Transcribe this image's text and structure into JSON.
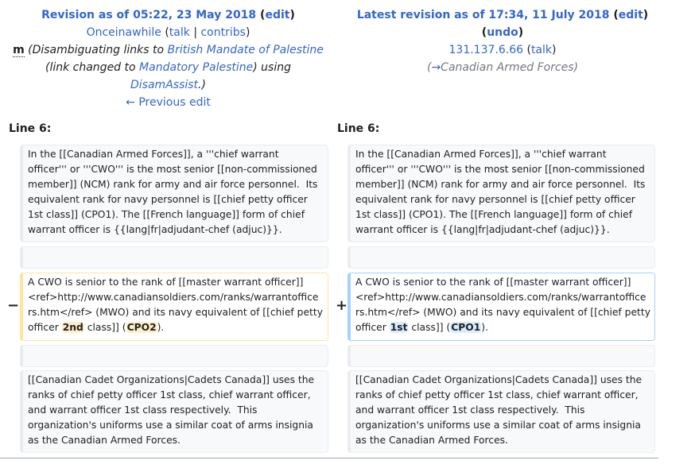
{
  "old": {
    "title_prefix": "Revision as of 05:22, 23 May 2018",
    "edit": "edit",
    "user": "Onceinawhile",
    "talk": "talk",
    "contribs": "contribs",
    "minor_flag": "m",
    "summary_1": "(Disambiguating links to ",
    "summary_link1": "British Mandate of Palestine",
    "summary_2": "(link changed to ",
    "summary_link2": "Mandatory Palestine",
    "summary_3": ") using",
    "summary_link3": "DisamAssist",
    "summary_4": ".)",
    "prev_edit": "← Previous edit"
  },
  "new": {
    "title_prefix": "Latest revision as of 17:34, 11 July 2018",
    "edit": "edit",
    "undo": "undo",
    "user": "131.137.6.66",
    "talk": "talk",
    "autocomment_open": "(",
    "autocomment_arrow": "→",
    "autocomment_section": "Canadian Armed Forces",
    "autocomment_close": ")"
  },
  "diff": {
    "line_left": "Line 6:",
    "line_right": "Line 6:",
    "context1": "In the [[Canadian Armed Forces]], a '''chief warrant\nofficer''' or '''CWO''' is the most senior [[non-commissioned\nmember]] (NCM) rank for army and air force personnel.  Its\nequivalent rank for navy personnel is [[chief petty officer\n1st class]] (CPO1). The [[French language]] form of chief\nwarrant officer is {{lang|fr|adjudant-chef (adjuc)}}.",
    "changed_prefix": "A CWO is senior to the rank of [[master warrant officer]]\n<ref>http://www.canadiansoldiers.com/ranks/warrantoffice\nrs.htm</ref> (MWO) and its navy equivalent of [[chief petty\nofficer ",
    "del_word1": "2nd",
    "add_word1": "1st",
    "changed_mid": " class]] (",
    "del_word2": "CPO2",
    "add_word2": "CPO1",
    "changed_suffix": ").",
    "minus": "−",
    "plus": "+",
    "context2": "[[Canadian Cadet Organizations|Cadets Canada]] uses the\nranks of chief petty officer 1st class, chief warrant officer,\nand warrant officer 1st class respectively.  This\norganization's uniforms use a similar coat of arms insignia\nas the Canadian Armed Forces."
  },
  "colors": {
    "link": "#3366cc",
    "deleted_border": "#ffe49c",
    "added_border": "#a3d3ff",
    "deleted_highlight": "#feeec8",
    "added_highlight": "#d8ecff"
  }
}
